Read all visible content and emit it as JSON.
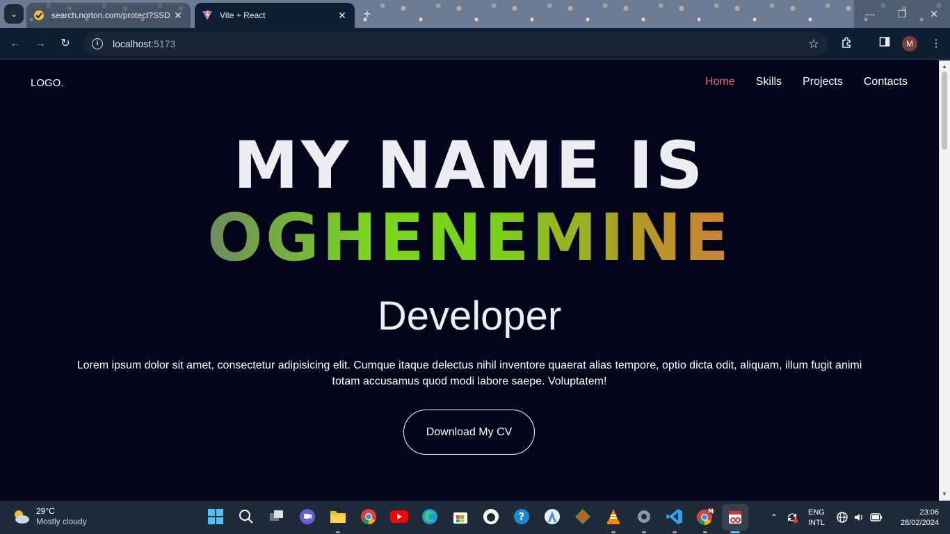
{
  "browser": {
    "tabs": [
      {
        "title": "search.norton.com/protect?SSD",
        "active": false
      },
      {
        "title": "Vite + React",
        "active": true
      }
    ],
    "url_host": "localhost",
    "url_port": ":5173",
    "profile_initial": "M"
  },
  "site": {
    "logo": "LOGO.",
    "nav": [
      {
        "label": "Home",
        "active": true
      },
      {
        "label": "Skills",
        "active": false
      },
      {
        "label": "Projects",
        "active": false
      },
      {
        "label": "Contacts",
        "active": false
      }
    ],
    "hero": {
      "line1": "MY NAME IS",
      "name": "OGHENEMINE",
      "role": "Developer",
      "description": "Lorem ipsum dolor sit amet, consectetur adipisicing elit. Cumque itaque delectus nihil inventore quaerat alias tempore, optio dicta odit, aliquam, illum fugit animi totam accusamus quod modi labore saepe. Voluptatem!",
      "cta": "Download My CV"
    },
    "colors": {
      "background": "#02041a",
      "accent": "#ef6b73"
    }
  },
  "taskbar": {
    "weather_temp": "29°C",
    "weather_condition": "Mostly cloudy",
    "lang_top": "ENG",
    "lang_bottom": "INTL",
    "time": "23:06",
    "date": "28/02/2024"
  }
}
